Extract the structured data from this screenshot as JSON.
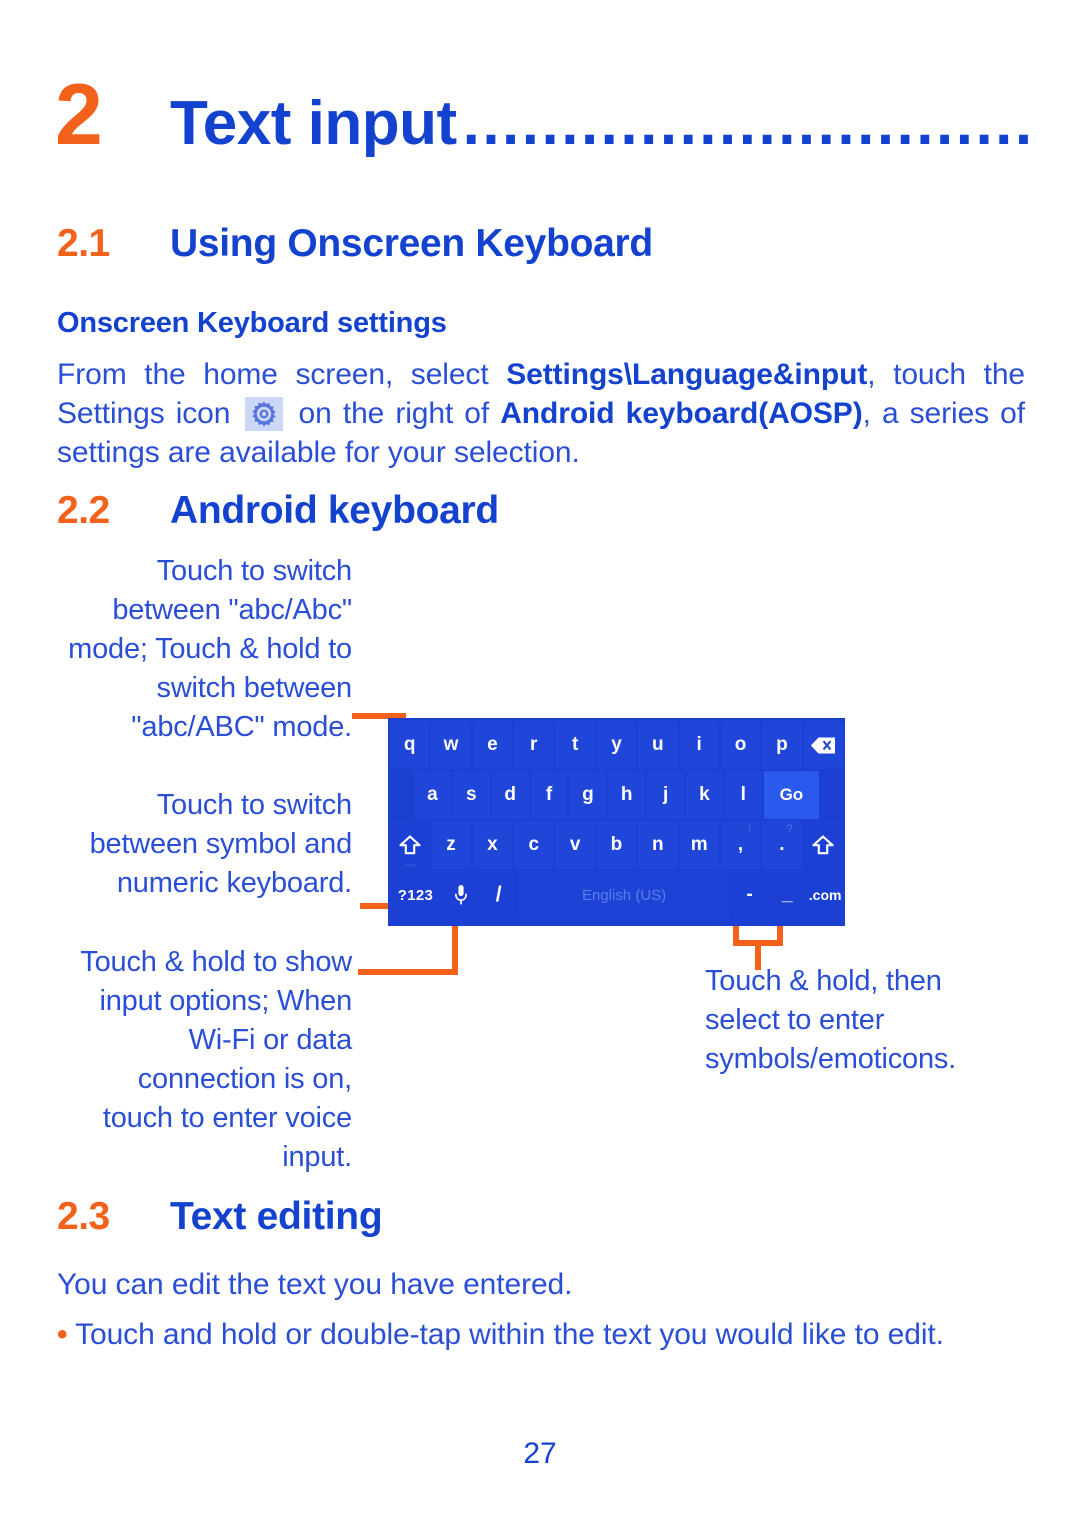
{
  "chapter": {
    "number": "2",
    "title": "Text input",
    "dots": "................................"
  },
  "sections": {
    "s21": {
      "num": "2.1",
      "title": "Using Onscreen Keyboard"
    },
    "s22": {
      "num": "2.2",
      "title": "Android keyboard"
    },
    "s23": {
      "num": "2.3",
      "title": "Text editing"
    }
  },
  "onscreen_settings": {
    "subheading": "Onscreen Keyboard settings",
    "para_part1": "From the home screen, select ",
    "para_bold1": "Settings\\Language&input",
    "para_part2": ", touch the Settings icon ",
    "gear_icon": "gear-icon",
    "para_part3": " on the right of ",
    "para_bold2": "Android keyboard(AOSP)",
    "para_part4": ", a series of settings are available for your selection."
  },
  "annotations": {
    "left_top": "Touch to switch between \"abc/Abc\" mode; Touch & hold to switch between \"abc/ABC\" mode.",
    "left_mid": "Touch to switch between symbol and numeric keyboard.",
    "left_bottom": "Touch & hold to show input options; When Wi-Fi or data connection is on, touch to enter voice input.",
    "right": "Touch & hold, then select to enter symbols/emoticons."
  },
  "text_editing": {
    "intro": "You can edit the text you have entered.",
    "bullet_mark": "•",
    "bullet_1": " Touch and hold or double-tap within the text you would like to edit."
  },
  "page_number": "27",
  "keyboard": {
    "row1": [
      "q",
      "w",
      "e",
      "r",
      "t",
      "y",
      "u",
      "i",
      "o",
      "p"
    ],
    "row1_extra": "backspace-icon",
    "row2": [
      "a",
      "s",
      "d",
      "f",
      "g",
      "h",
      "j",
      "k",
      "l"
    ],
    "row2_action": "Go",
    "row3_shift_left": "shift-icon",
    "row3": [
      "z",
      "x",
      "c",
      "v",
      "b",
      "n",
      "m"
    ],
    "row3_comma": ",",
    "row3_comma_hint": "!",
    "row3_period": ".",
    "row3_period_hint": "?",
    "row3_shift_right": "shift-icon",
    "row4_symbols": "?123",
    "row4_mic": "microphone-icon",
    "row4_slash": "/",
    "row4_space_label": "English (US)",
    "row4_hyphen": "-",
    "row4_underscore": "_",
    "row4_dotcom": ".com"
  },
  "colors": {
    "accent_orange": "#f4611b",
    "heading_blue": "#1342cf",
    "body_blue": "#2a4fd6",
    "keyboard_blue": "#1a3fd1",
    "key_blue": "#1f45d9",
    "go_key_blue": "#2a59ee"
  }
}
